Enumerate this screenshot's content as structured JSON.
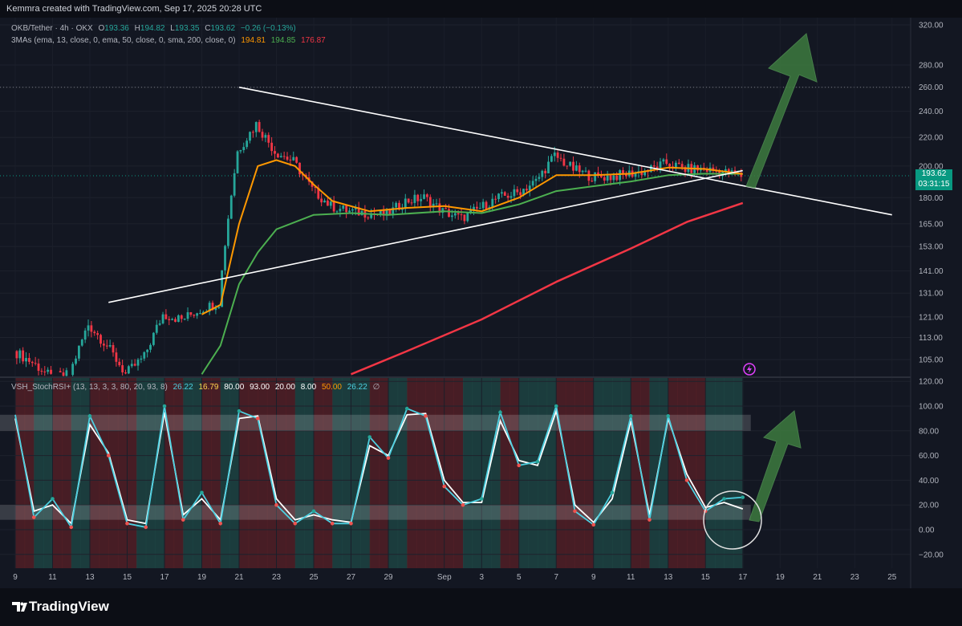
{
  "header": {
    "title": "Kemmra created with TradingView.com, Sep 17, 2025 20:28 UTC"
  },
  "legend": {
    "symbol": "OKB/Tether · 4h · OKX",
    "o_label": "O",
    "o_value": "193.36",
    "h_label": "H",
    "h_value": "194.82",
    "l_label": "L",
    "l_value": "193.35",
    "c_label": "C",
    "c_value": "193.62",
    "change": "−0.26 (−0.13%)",
    "ma_name": "3MAs (ema, 13, close, 0, ema, 50, close, 0, sma, 200, close, 0)",
    "ma_values": [
      "194.81",
      "194.85",
      "176.87"
    ]
  },
  "osc_legend": {
    "name": "VSH_StochRSI+ (13, 13, 3, 3, 80, 20, 93, 8)",
    "values": [
      "26.22",
      "16.79",
      "80.00",
      "93.00",
      "20.00",
      "8.00",
      "50.00",
      "26.22"
    ],
    "tail": "∅"
  },
  "price_badge": {
    "price": "193.62",
    "countdown": "03:31:15"
  },
  "colors": {
    "background": "#131722",
    "up": "#26a69a",
    "down": "#f23645",
    "ema13": "#ff9800",
    "ema50": "#4caf50",
    "sma200": "#f23645",
    "stoch_k": "#4dd0e1",
    "stoch_d": "#ffffff",
    "stoch_signal": "#ffb300",
    "arrow": "#3d7a3f"
  },
  "footer": {
    "logo_text": "TradingView",
    "logo_icon": "tradingview-logo-icon"
  },
  "chart_data": [
    {
      "type": "candlestick",
      "title": "OKB/Tether · 4h · OKX",
      "y_scale": "log",
      "y_ticks": [
        105,
        113,
        121,
        131,
        141,
        153,
        165,
        180,
        200,
        220,
        240,
        260,
        280,
        320
      ],
      "y_tick_labels": [
        "105.00",
        "113.00",
        "121.00",
        "131.00",
        "141.00",
        "153.00",
        "165.00",
        "180.00",
        "200.00",
        "220.00",
        "240.00",
        "260.00",
        "280.00",
        "320.00"
      ],
      "x_tick_labels": [
        "9",
        "11",
        "13",
        "15",
        "17",
        "19",
        "21",
        "23",
        "25",
        "27",
        "29",
        "Sep",
        "3",
        "5",
        "7",
        "9",
        "11",
        "13",
        "15",
        "17",
        "19",
        "21",
        "23",
        "25"
      ],
      "x_ticks": [
        "2025-08-09",
        "2025-08-11",
        "2025-08-13",
        "2025-08-15",
        "2025-08-17",
        "2025-08-19",
        "2025-08-21",
        "2025-08-23",
        "2025-08-25",
        "2025-08-27",
        "2025-08-29",
        "2025-09-01",
        "2025-09-03",
        "2025-09-05",
        "2025-09-07",
        "2025-09-09",
        "2025-09-11",
        "2025-09-13",
        "2025-09-15",
        "2025-09-17",
        "2025-09-19",
        "2025-09-21",
        "2025-09-23",
        "2025-09-25"
      ],
      "x_range": [
        "2025-08-09",
        "2025-09-25"
      ],
      "price_path": [
        [
          "2025-08-09",
          108
        ],
        [
          "2025-08-10",
          104
        ],
        [
          "2025-08-11",
          99
        ],
        [
          "2025-08-12",
          100
        ],
        [
          "2025-08-13",
          118
        ],
        [
          "2025-08-14",
          110
        ],
        [
          "2025-08-15",
          100
        ],
        [
          "2025-08-16",
          106
        ],
        [
          "2025-08-17",
          122
        ],
        [
          "2025-08-18",
          120
        ],
        [
          "2025-08-19",
          124
        ],
        [
          "2025-08-20",
          127
        ],
        [
          "2025-08-21",
          210
        ],
        [
          "2025-08-22",
          230
        ],
        [
          "2025-08-23",
          210
        ],
        [
          "2025-08-24",
          203
        ],
        [
          "2025-08-25",
          185
        ],
        [
          "2025-08-26",
          175
        ],
        [
          "2025-08-27",
          172
        ],
        [
          "2025-08-28",
          171
        ],
        [
          "2025-08-29",
          170
        ],
        [
          "2025-08-30",
          178
        ],
        [
          "2025-08-31",
          180
        ],
        [
          "2025-09-01",
          172
        ],
        [
          "2025-09-02",
          168
        ],
        [
          "2025-09-03",
          174
        ],
        [
          "2025-09-04",
          180
        ],
        [
          "2025-09-05",
          183
        ],
        [
          "2025-09-06",
          190
        ],
        [
          "2025-09-07",
          207
        ],
        [
          "2025-09-08",
          198
        ],
        [
          "2025-09-09",
          193
        ],
        [
          "2025-09-10",
          193
        ],
        [
          "2025-09-11",
          195
        ],
        [
          "2025-09-12",
          197
        ],
        [
          "2025-09-13",
          202
        ],
        [
          "2025-09-14",
          198
        ],
        [
          "2025-09-15",
          198
        ],
        [
          "2025-09-16",
          196
        ],
        [
          "2025-09-17",
          193.62
        ]
      ],
      "ema13": [
        [
          "2025-08-19",
          122
        ],
        [
          "2025-08-20",
          126
        ],
        [
          "2025-08-21",
          165
        ],
        [
          "2025-08-22",
          200
        ],
        [
          "2025-08-23",
          204
        ],
        [
          "2025-08-24",
          200
        ],
        [
          "2025-08-25",
          188
        ],
        [
          "2025-08-26",
          178
        ],
        [
          "2025-08-28",
          172
        ],
        [
          "2025-08-30",
          174
        ],
        [
          "2025-09-01",
          175
        ],
        [
          "2025-09-03",
          172
        ],
        [
          "2025-09-05",
          180
        ],
        [
          "2025-09-07",
          194
        ],
        [
          "2025-09-09",
          194
        ],
        [
          "2025-09-11",
          195
        ],
        [
          "2025-09-13",
          199
        ],
        [
          "2025-09-15",
          198
        ],
        [
          "2025-09-17",
          194.81
        ]
      ],
      "ema50": [
        [
          "2025-08-19",
          100
        ],
        [
          "2025-08-20",
          110
        ],
        [
          "2025-08-21",
          135
        ],
        [
          "2025-08-22",
          150
        ],
        [
          "2025-08-23",
          162
        ],
        [
          "2025-08-25",
          170
        ],
        [
          "2025-08-27",
          171
        ],
        [
          "2025-08-29",
          170
        ],
        [
          "2025-09-01",
          172
        ],
        [
          "2025-09-03",
          171
        ],
        [
          "2025-09-05",
          176
        ],
        [
          "2025-09-07",
          184
        ],
        [
          "2025-09-09",
          187
        ],
        [
          "2025-09-11",
          190
        ],
        [
          "2025-09-13",
          194
        ],
        [
          "2025-09-15",
          195
        ],
        [
          "2025-09-17",
          194.85
        ]
      ],
      "sma200": [
        [
          "2025-08-27",
          100
        ],
        [
          "2025-08-30",
          108
        ],
        [
          "2025-09-03",
          120
        ],
        [
          "2025-09-07",
          136
        ],
        [
          "2025-09-11",
          152
        ],
        [
          "2025-09-14",
          166
        ],
        [
          "2025-09-17",
          176.87
        ]
      ],
      "trendlines": [
        {
          "name": "descending-resistance",
          "from": [
            "2025-08-21",
            260
          ],
          "to": [
            "2025-09-25",
            170
          ]
        },
        {
          "name": "ascending-support",
          "from": [
            "2025-08-14",
            127
          ],
          "to": [
            "2025-09-17",
            197
          ]
        }
      ],
      "resistance_level": 260,
      "last_price": 193.62
    },
    {
      "type": "line",
      "title": "VSH_StochRSI+",
      "y_ticks": [
        -20,
        0,
        20,
        40,
        60,
        80,
        100,
        120
      ],
      "y_tick_labels": [
        "−20.00",
        "0.00",
        "20.00",
        "40.00",
        "60.00",
        "80.00",
        "100.00",
        "120.00"
      ],
      "bands": [
        [
          80,
          93
        ],
        [
          8,
          20
        ]
      ],
      "series": [
        {
          "values": [
            [
              "2025-08-09",
              93
            ],
            [
              "2025-08-10",
              10
            ],
            [
              "2025-08-11",
              25
            ],
            [
              "2025-08-12",
              2
            ],
            [
              "2025-08-13",
              92
            ],
            [
              "2025-08-14",
              60
            ],
            [
              "2025-08-15",
              5
            ],
            [
              "2025-08-16",
              2
            ],
            [
              "2025-08-17",
              100
            ],
            [
              "2025-08-18",
              8
            ],
            [
              "2025-08-19",
              30
            ],
            [
              "2025-08-20",
              5
            ],
            [
              "2025-08-21",
              96
            ],
            [
              "2025-08-22",
              90
            ],
            [
              "2025-08-23",
              20
            ],
            [
              "2025-08-24",
              5
            ],
            [
              "2025-08-25",
              15
            ],
            [
              "2025-08-26",
              5
            ],
            [
              "2025-08-27",
              5
            ],
            [
              "2025-08-28",
              75
            ],
            [
              "2025-08-29",
              58
            ],
            [
              "2025-08-30",
              98
            ],
            [
              "2025-08-31",
              92
            ],
            [
              "2025-09-01",
              35
            ],
            [
              "2025-09-02",
              20
            ],
            [
              "2025-09-03",
              25
            ],
            [
              "2025-09-04",
              95
            ],
            [
              "2025-09-05",
              52
            ],
            [
              "2025-09-06",
              55
            ],
            [
              "2025-09-07",
              100
            ],
            [
              "2025-09-08",
              15
            ],
            [
              "2025-09-09",
              4
            ],
            [
              "2025-09-10",
              30
            ],
            [
              "2025-09-11",
              92
            ],
            [
              "2025-09-12",
              8
            ],
            [
              "2025-09-13",
              92
            ],
            [
              "2025-09-14",
              40
            ],
            [
              "2025-09-15",
              15
            ],
            [
              "2025-09-16",
              25
            ],
            [
              "2025-09-17",
              26.22
            ]
          ]
        },
        {
          "values": [
            [
              "2025-08-09",
              90
            ],
            [
              "2025-08-10",
              15
            ],
            [
              "2025-08-11",
              20
            ],
            [
              "2025-08-12",
              5
            ],
            [
              "2025-08-13",
              85
            ],
            [
              "2025-08-14",
              62
            ],
            [
              "2025-08-15",
              8
            ],
            [
              "2025-08-16",
              5
            ],
            [
              "2025-08-17",
              95
            ],
            [
              "2025-08-18",
              12
            ],
            [
              "2025-08-19",
              25
            ],
            [
              "2025-08-20",
              8
            ],
            [
              "2025-08-21",
              90
            ],
            [
              "2025-08-22",
              92
            ],
            [
              "2025-08-23",
              25
            ],
            [
              "2025-08-24",
              8
            ],
            [
              "2025-08-25",
              12
            ],
            [
              "2025-08-26",
              8
            ],
            [
              "2025-08-27",
              6
            ],
            [
              "2025-08-28",
              68
            ],
            [
              "2025-08-29",
              60
            ],
            [
              "2025-08-30",
              93
            ],
            [
              "2025-08-31",
              94
            ],
            [
              "2025-09-01",
              40
            ],
            [
              "2025-09-02",
              22
            ],
            [
              "2025-09-03",
              22
            ],
            [
              "2025-09-04",
              88
            ],
            [
              "2025-09-05",
              56
            ],
            [
              "2025-09-06",
              52
            ],
            [
              "2025-09-07",
              96
            ],
            [
              "2025-09-08",
              20
            ],
            [
              "2025-09-09",
              6
            ],
            [
              "2025-09-10",
              25
            ],
            [
              "2025-09-11",
              88
            ],
            [
              "2025-09-12",
              12
            ],
            [
              "2025-09-13",
              90
            ],
            [
              "2025-09-14",
              45
            ],
            [
              "2025-09-15",
              18
            ],
            [
              "2025-09-16",
              22
            ],
            [
              "2025-09-17",
              16.79
            ]
          ]
        }
      ]
    }
  ]
}
